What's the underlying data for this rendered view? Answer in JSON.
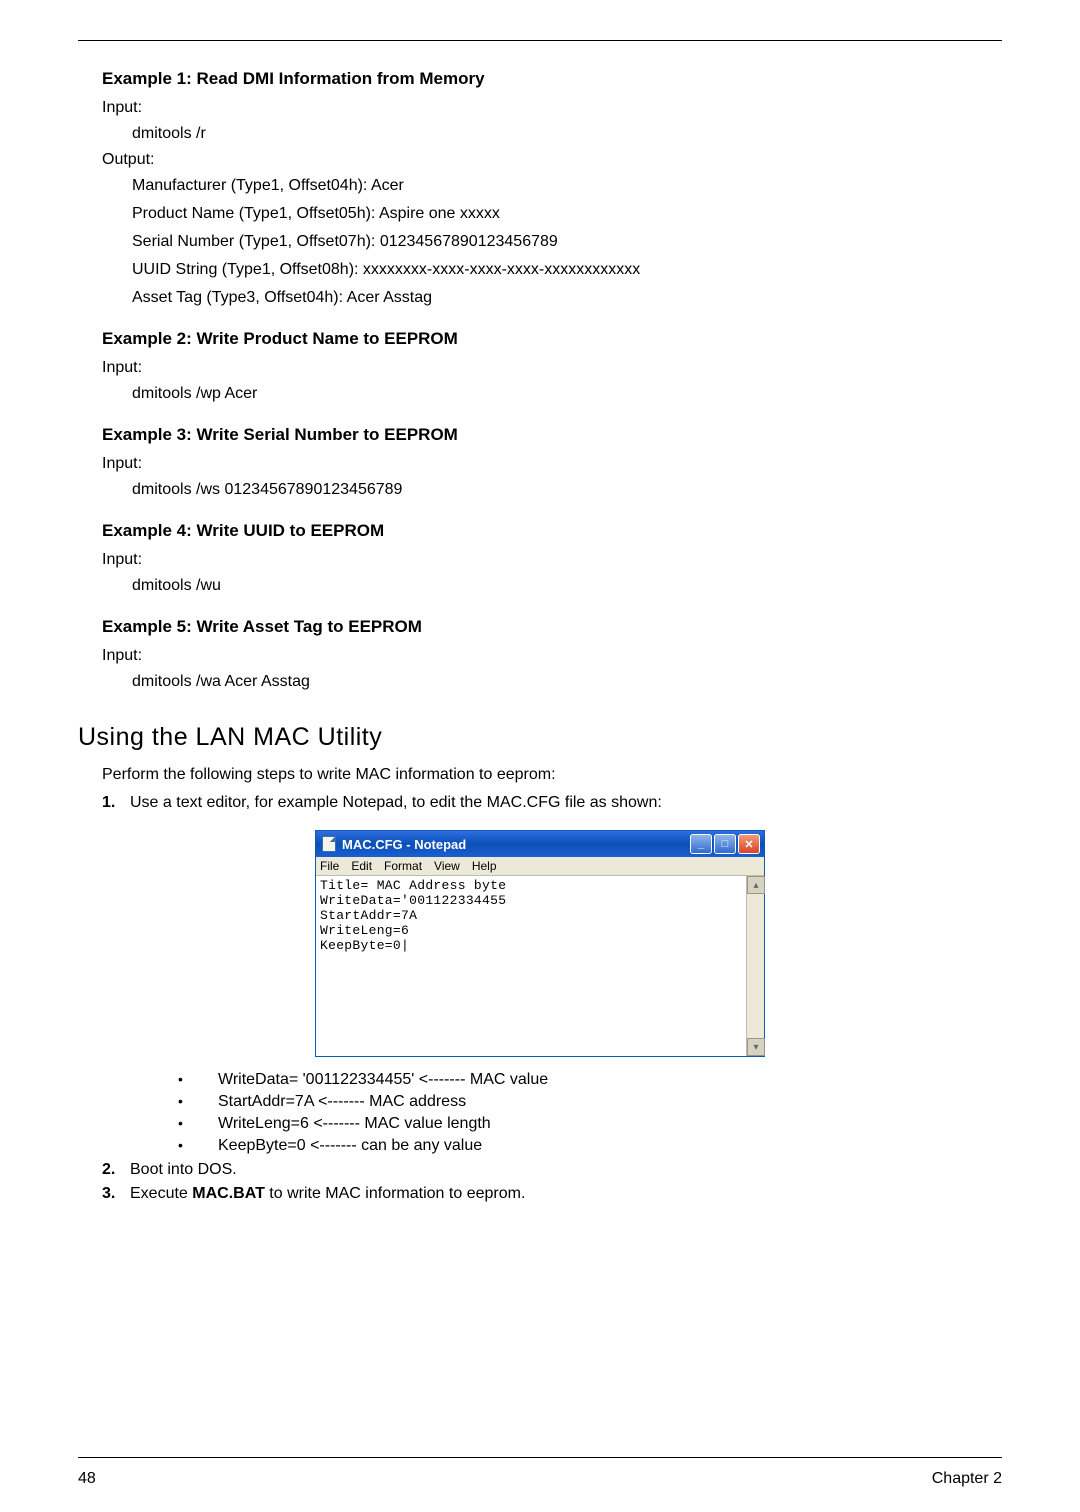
{
  "examples": {
    "ex1": {
      "title": "Example 1: Read DMI Information from Memory",
      "input_label": "Input:",
      "cmd": "dmitools /r",
      "output_label": "Output:",
      "out": [
        "Manufacturer (Type1, Offset04h): Acer",
        "Product Name (Type1, Offset05h): Aspire one xxxxx",
        "Serial Number (Type1, Offset07h): 01234567890123456789",
        "UUID String (Type1, Offset08h): xxxxxxxx-xxxx-xxxx-xxxx-xxxxxxxxxxxx",
        "Asset Tag (Type3, Offset04h): Acer Asstag"
      ]
    },
    "ex2": {
      "title": "Example 2: Write Product Name to EEPROM",
      "input_label": "Input:",
      "cmd": "dmitools /wp Acer"
    },
    "ex3": {
      "title": "Example 3: Write Serial Number to EEPROM",
      "input_label": "Input:",
      "cmd": "dmitools /ws 01234567890123456789"
    },
    "ex4": {
      "title": "Example 4: Write UUID to EEPROM",
      "input_label": "Input:",
      "cmd": "dmitools /wu"
    },
    "ex5": {
      "title": "Example 5: Write Asset Tag to EEPROM",
      "input_label": "Input:",
      "cmd": "dmitools /wa Acer Asstag"
    }
  },
  "section": {
    "header": "Using the LAN MAC Utility",
    "intro": "Perform the following steps to write MAC information to eeprom:",
    "step1_num": "1.",
    "step1_text": "Use a text editor, for example Notepad, to edit the MAC.CFG file as shown:",
    "step2_num": "2.",
    "step2_text": "Boot into DOS.",
    "step3_num": "3.",
    "step3_pre": "Execute ",
    "step3_bold": "MAC.BAT",
    "step3_post": " to write MAC information to eeprom."
  },
  "notepad": {
    "title": "MAC.CFG - Notepad",
    "menu": {
      "file": "File",
      "edit": "Edit",
      "format": "Format",
      "view": "View",
      "help": "Help"
    },
    "content": "Title= MAC Address byte\nWriteData='001122334455\nStartAddr=7A\nWriteLeng=6\nKeepByte=0|",
    "min": "_",
    "max": "□",
    "close": "✕",
    "up": "▴",
    "down": "▾"
  },
  "bullets": {
    "b1": "WriteData= '001122334455' <------- MAC value",
    "b2": "StartAddr=7A <------- MAC address",
    "b3": "WriteLeng=6 <------- MAC value length",
    "b4": "KeepByte=0 <------- can be any value",
    "dot": "•"
  },
  "footer": {
    "left": "48",
    "right": "Chapter 2"
  }
}
